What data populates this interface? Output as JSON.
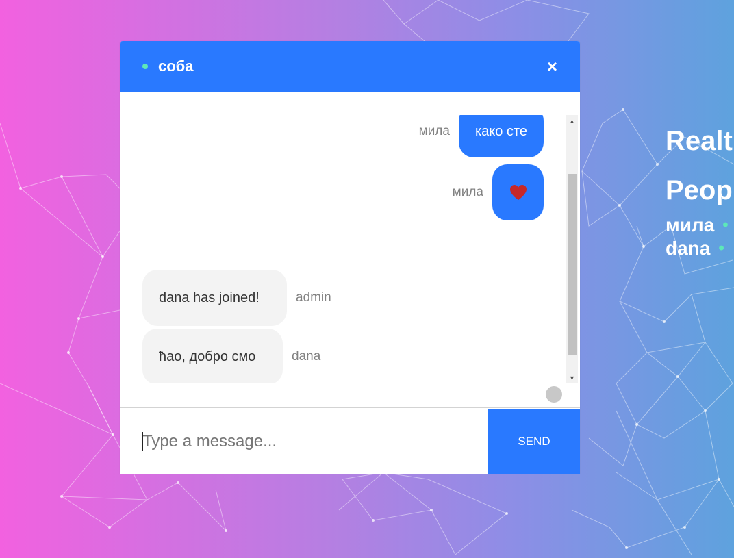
{
  "room": {
    "name": "соба",
    "status_color": "#5de8b8"
  },
  "header": {
    "close_label": "×"
  },
  "messages": [
    {
      "text": "како сте",
      "sender": "мила",
      "mine": true
    },
    {
      "text": "❤",
      "sender": "мила",
      "mine": true,
      "icon": "heart-icon"
    },
    {
      "text": "dana has joined!",
      "sender": "admin",
      "mine": false
    },
    {
      "text": "ћао, добро смо",
      "sender": "dana",
      "mine": false
    },
    {
      "text": "😃",
      "sender": "dana",
      "mine": false,
      "icon": "smiley-icon"
    }
  ],
  "composer": {
    "placeholder": "Type a message...",
    "send_label": "send"
  },
  "sidebar": {
    "heading_1": "Realt",
    "heading_2": "Peop",
    "users": [
      "мила",
      "dana"
    ]
  },
  "colors": {
    "accent": "#2979ff",
    "bubble_other": "#f3f3f3",
    "online": "#5de8b8",
    "heart": "#c62828"
  }
}
